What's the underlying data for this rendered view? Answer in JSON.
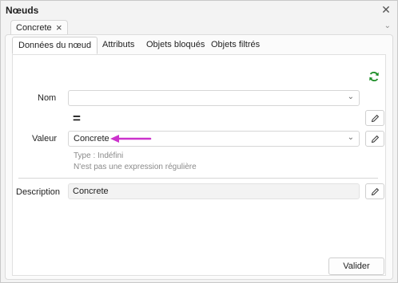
{
  "window": {
    "title": "Nœuds"
  },
  "doc_tab": {
    "label": "Concrete"
  },
  "tabs": [
    {
      "label": "Données du nœud"
    },
    {
      "label": "Attributs"
    },
    {
      "label": "Objets bloqués"
    },
    {
      "label": "Objets filtrés"
    }
  ],
  "form": {
    "nom_label": "Nom",
    "nom_value": "",
    "equals_symbol": "=",
    "valeur_label": "Valeur",
    "valeur_value": "Concrete",
    "type_hint": "Type : Indéfini",
    "regex_hint": "N'est pas une expression régulière",
    "description_label": "Description",
    "description_value": "Concrete"
  },
  "buttons": {
    "validate": "Valider"
  },
  "colors": {
    "refresh": "#1f8f2a",
    "arrow": "#cc33cc"
  }
}
